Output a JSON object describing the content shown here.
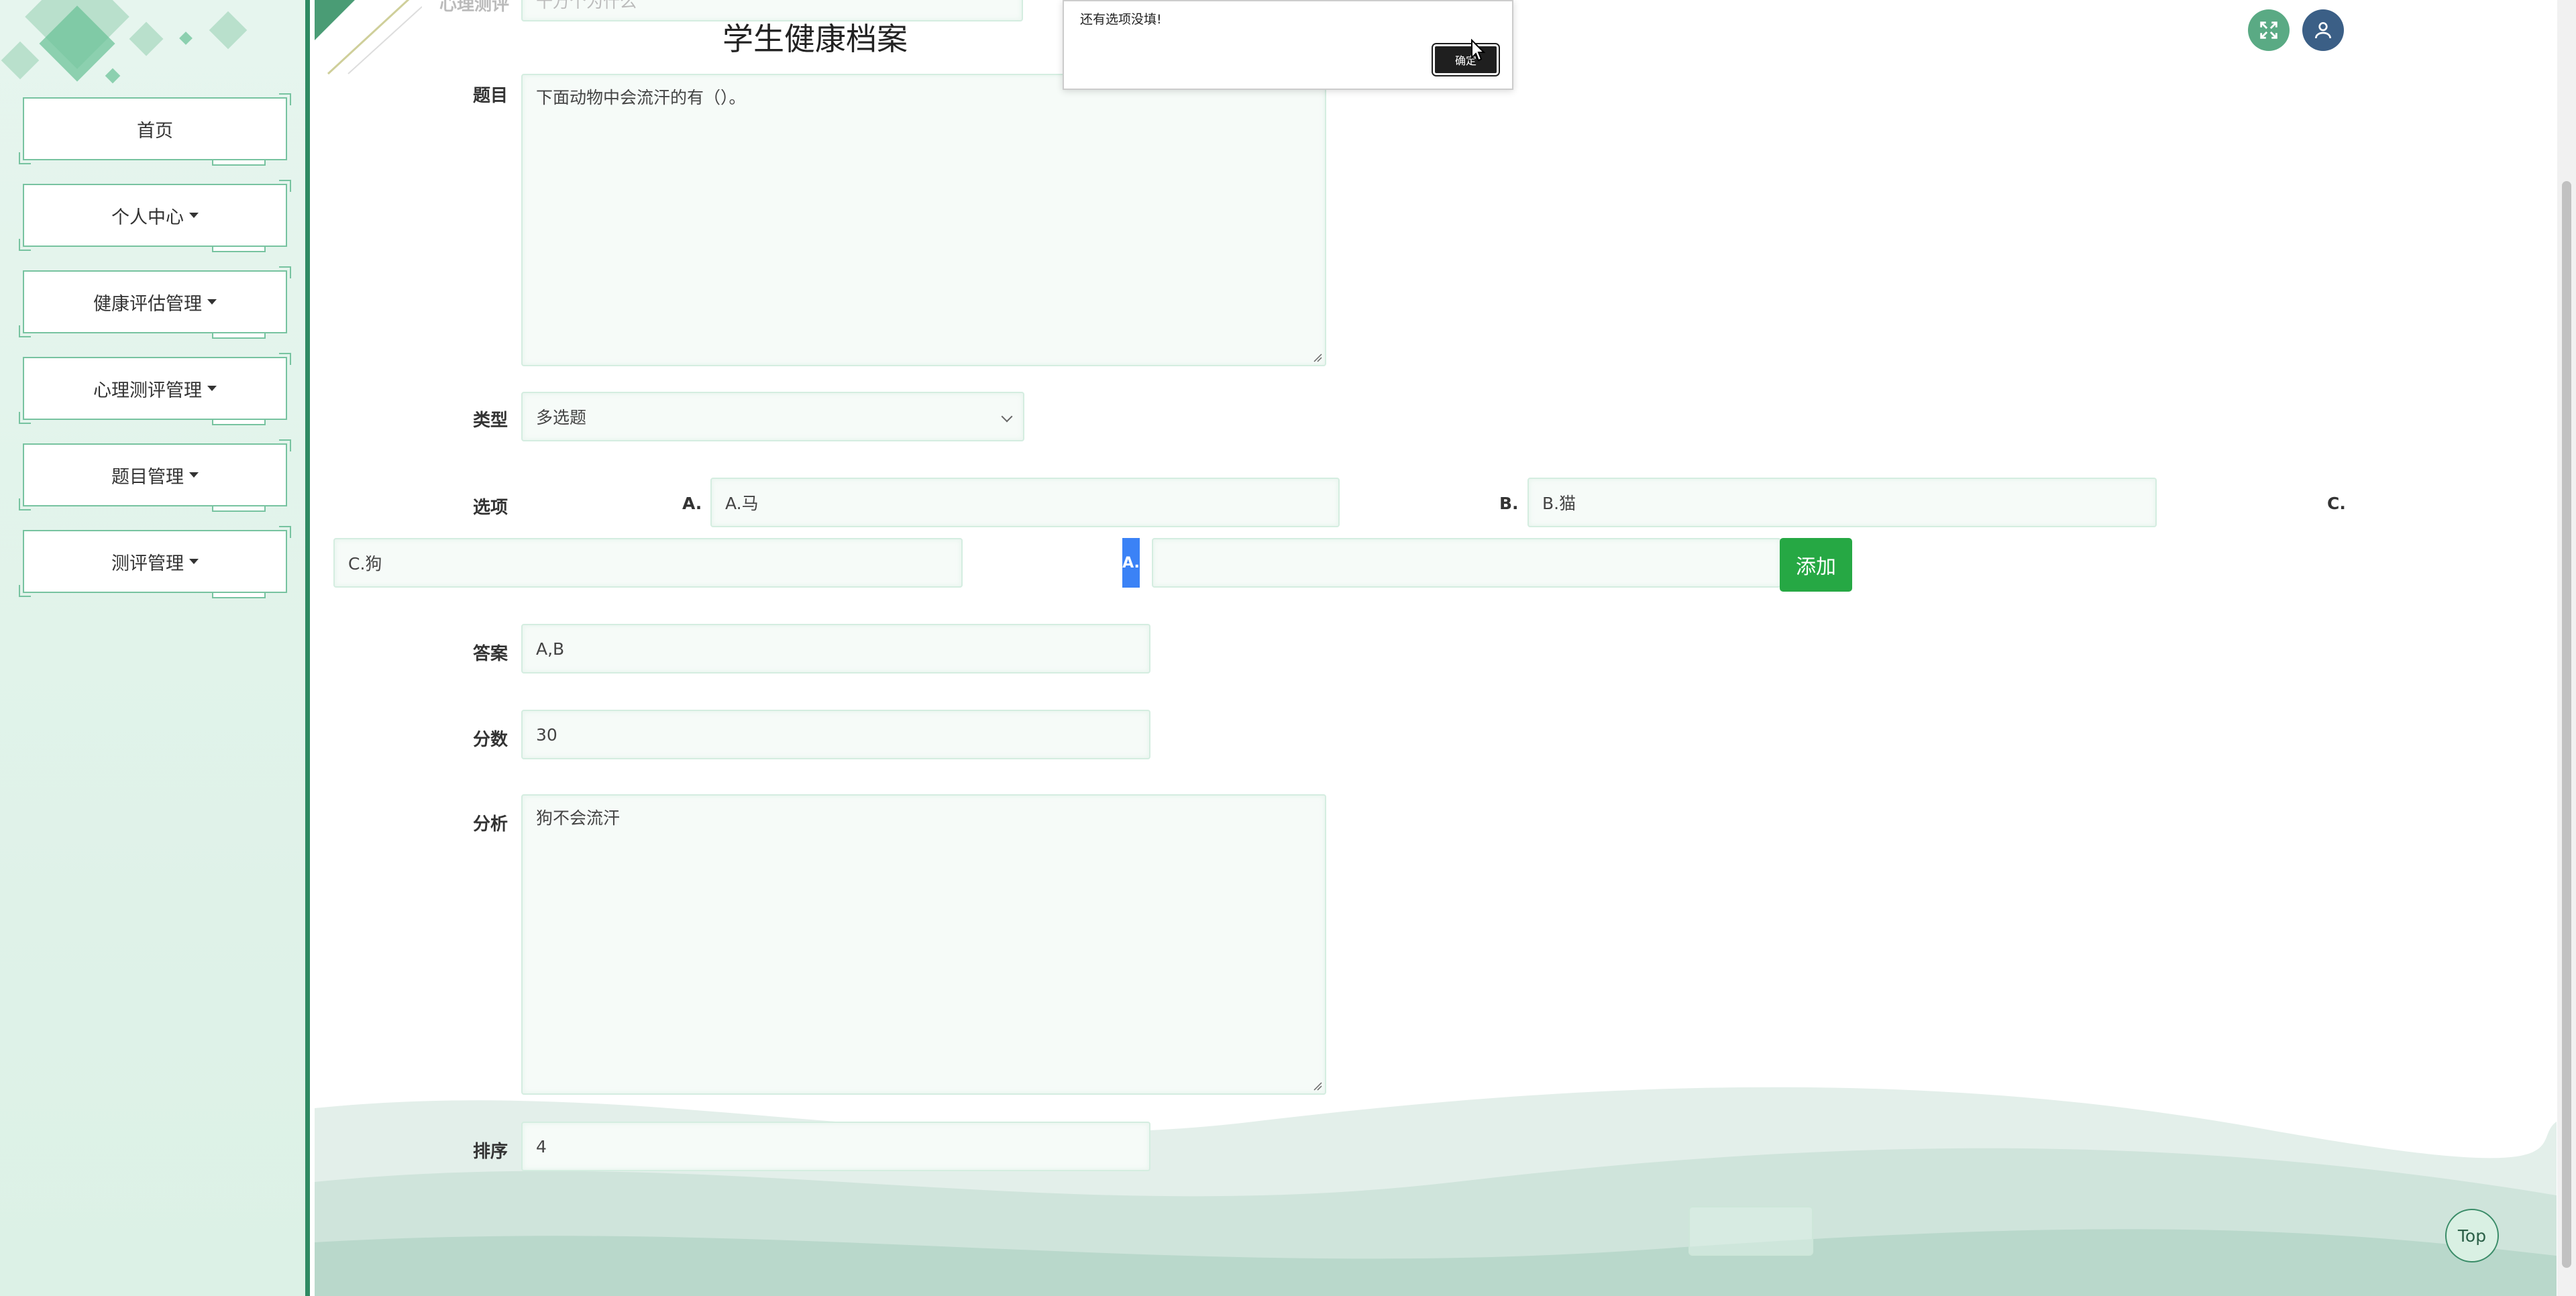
{
  "header": {
    "site_title": "学生健康档案"
  },
  "sidebar": {
    "items": [
      {
        "label": "首页",
        "dropdown": false
      },
      {
        "label": "个人中心",
        "dropdown": true
      },
      {
        "label": "健康评估管理",
        "dropdown": true
      },
      {
        "label": "心理测评管理",
        "dropdown": true
      },
      {
        "label": "题目管理",
        "dropdown": true
      },
      {
        "label": "测评管理",
        "dropdown": true
      }
    ]
  },
  "form": {
    "faded_top_label": "心理测评",
    "faded_top_value": "十万个为什么",
    "question_label": "题目",
    "question_value": "下面动物中会流汗的有（）。",
    "type_label": "类型",
    "type_value": "多选题",
    "options_label": "选项",
    "options": [
      {
        "letter": "A.",
        "value": "A.马"
      },
      {
        "letter": "B.",
        "value": "B.猫"
      },
      {
        "letter": "C.",
        "value": "C.狗"
      }
    ],
    "new_option_letter": "A.",
    "new_option_value": "",
    "add_button": "添加",
    "answer_label": "答案",
    "answer_value": "A,B",
    "score_label": "分数",
    "score_value": "30",
    "analysis_label": "分析",
    "analysis_value": "狗不会流汗",
    "order_label": "排序",
    "order_value": "4"
  },
  "dialog": {
    "message": "还有选项没填!",
    "ok_label": "确定"
  },
  "back_to_top": "Top",
  "colors": {
    "accent_green": "#2f8a63",
    "add_button": "#26a844",
    "fullscreen_icon_bg": "#5aaa84",
    "user_icon_bg": "#3b5f86"
  }
}
